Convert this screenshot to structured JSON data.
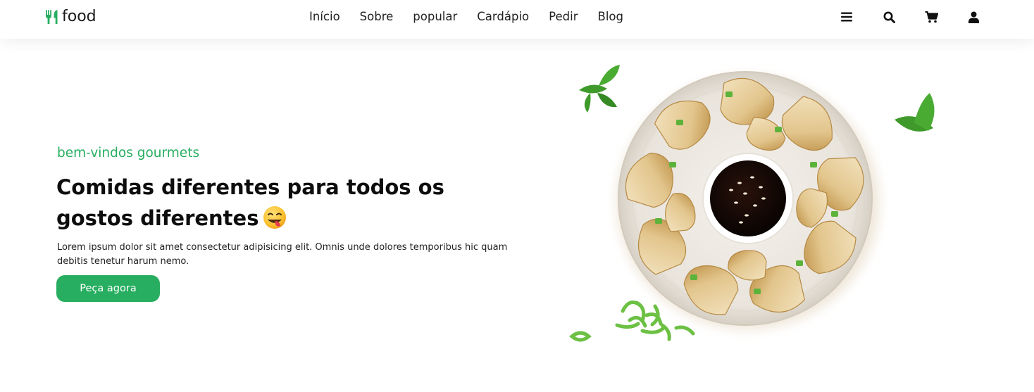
{
  "brand": {
    "name": "food",
    "accent": "#27ae60"
  },
  "nav": {
    "items": [
      "Início",
      "Sobre",
      "popular",
      "Cardápio",
      "Pedir",
      "Blog"
    ]
  },
  "header_icons": [
    "menu-icon",
    "search-icon",
    "cart-icon",
    "user-icon"
  ],
  "hero": {
    "tagline": "bem-vindos gourmets",
    "headline": "Comidas diferentes para todos os gostos diferentes",
    "description": "Lorem ipsum dolor sit amet consectetur adipisicing elit. Omnis unde dolores temporibus hic quam debitis tenetur harum nemo.",
    "cta_label": "Peça agora"
  }
}
